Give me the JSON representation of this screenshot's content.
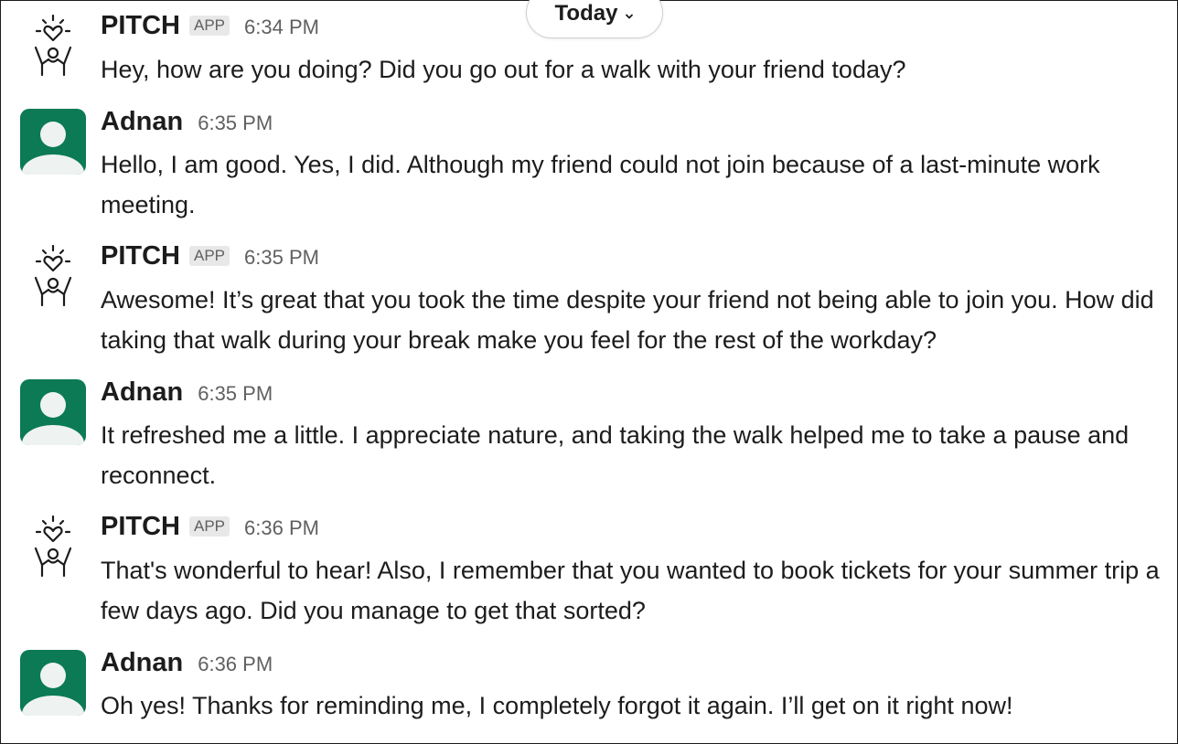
{
  "date_divider": {
    "label": "Today"
  },
  "messages": [
    {
      "sender": "PITCH",
      "badge": "APP",
      "time": "6:34 PM",
      "text": "Hey, how are you doing? Did you go out for a walk with your friend today?"
    },
    {
      "sender": "Adnan",
      "time": "6:35 PM",
      "text": "Hello, I am good. Yes, I did. Although my friend could not join because of a last-minute work meeting."
    },
    {
      "sender": "PITCH",
      "badge": "APP",
      "time": "6:35 PM",
      "text": "Awesome! It’s great that you took the time despite your friend not being able to join you. How did taking that walk during your break make you feel for the rest of the workday?"
    },
    {
      "sender": "Adnan",
      "time": "6:35 PM",
      "text": "It refreshed me a little. I appreciate nature, and taking the walk helped me to take a pause and reconnect."
    },
    {
      "sender": "PITCH",
      "badge": "APP",
      "time": "6:36 PM",
      "text": "That's wonderful to hear! Also, I remember that you wanted to book tickets for your summer trip a few days ago. Did you manage to get that sorted?"
    },
    {
      "sender": "Adnan",
      "time": "6:36 PM",
      "text": "Oh yes! Thanks for reminding me, I completely forgot it again. I’ll get on it right now!"
    }
  ],
  "colors": {
    "user_avatar_bg": "#0b7a55",
    "text": "#1d1c1d",
    "muted": "#616061"
  },
  "icons": {
    "bot_avatar": "pitch-heart-person-icon",
    "user_avatar": "user-silhouette-icon",
    "date_chevron": "chevron-down-icon"
  }
}
